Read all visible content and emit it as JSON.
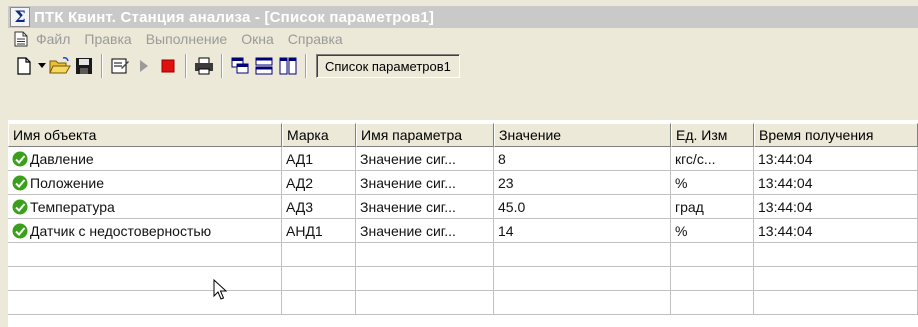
{
  "window": {
    "title": "ПТК Квинт. Станция анализа - [Список параметров1]",
    "app_icon": "sigma-icon"
  },
  "menu": {
    "items": [
      "Файл",
      "Правка",
      "Выполнение",
      "Окна",
      "Справка"
    ]
  },
  "toolbar": {
    "icons": [
      "new-document-icon",
      "dropdown-arrow-icon",
      "open-folder-icon",
      "save-icon",
      "properties-icon",
      "play-icon",
      "stop-icon",
      "print-icon",
      "cascade-windows-icon",
      "tile-horizontal-icon",
      "tile-vertical-icon"
    ],
    "window_tab": "Список параметров1"
  },
  "table": {
    "columns": [
      "Имя объекта",
      "Марка",
      "Имя параметра",
      "Значение",
      "Ед. Изм",
      "Время получения"
    ],
    "rows": [
      {
        "status": "ok",
        "object": "Давление",
        "mark": "АД1",
        "param": "Значение сиг...",
        "value": "8",
        "unit": "кгс/с...",
        "time": "13:44:04"
      },
      {
        "status": "ok",
        "object": "Положение",
        "mark": "АД2",
        "param": "Значение сиг...",
        "value": "23",
        "unit": "%",
        "time": "13:44:04"
      },
      {
        "status": "ok",
        "object": "Температура",
        "mark": "АД3",
        "param": "Значение сиг...",
        "value": "45.0",
        "unit": "град",
        "time": "13:44:04"
      },
      {
        "status": "ok",
        "object": "Датчик с недостоверностью",
        "mark": "АНД1",
        "param": "Значение сиг...",
        "value": "14",
        "unit": "%",
        "time": "13:44:04"
      }
    ],
    "empty_rows": 3
  },
  "colors": {
    "status_ok": "#3aa01c",
    "stop_red": "#e01010",
    "sigma_blue": "#0b2a8c"
  }
}
